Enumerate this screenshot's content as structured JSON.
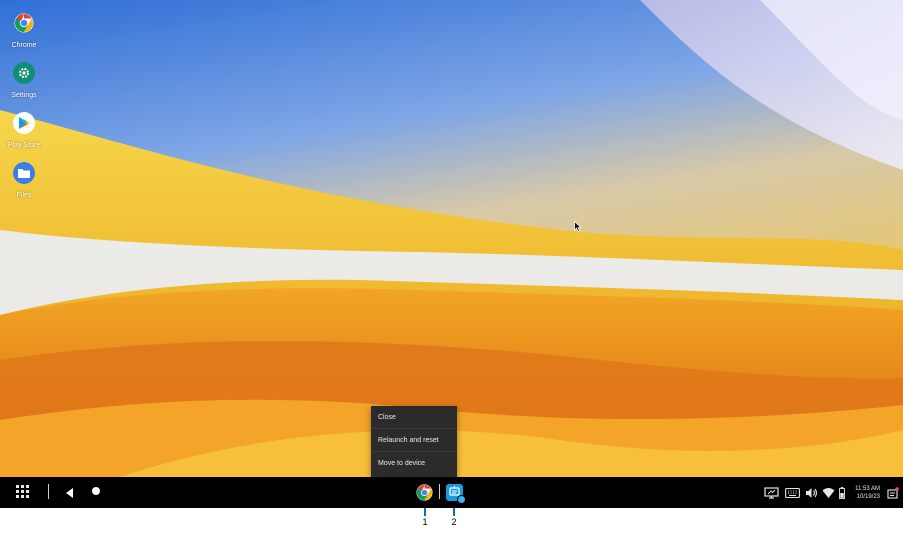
{
  "desktop": {
    "icons": [
      {
        "label": "Chrome",
        "icon": "chrome-icon"
      },
      {
        "label": "Settings",
        "icon": "gear-icon"
      },
      {
        "label": "Play Store",
        "icon": "play-store-icon"
      },
      {
        "label": "Files",
        "icon": "folder-icon"
      }
    ]
  },
  "context_menu": {
    "items": [
      {
        "label": "Close"
      },
      {
        "label": "Relaunch and reset"
      },
      {
        "label": "Move to device"
      }
    ]
  },
  "taskbar": {
    "launcher_icon": "app-grid-icon",
    "back_icon": "back-triangle-icon",
    "home_icon": "home-circle-icon",
    "apps": [
      {
        "icon": "chrome-icon"
      },
      {
        "icon": "helper-app-icon"
      }
    ],
    "tray": {
      "icons": [
        "screen-cast-icon",
        "keyboard-icon",
        "volume-icon",
        "wifi-icon",
        "battery-icon",
        "notifications-icon"
      ],
      "time": "11:53 AM",
      "date": "10/19/23"
    }
  },
  "annotations": {
    "markers": [
      {
        "label": "1"
      },
      {
        "label": "2"
      }
    ]
  },
  "colors": {
    "taskbar_bg": "#000000",
    "menu_bg": "#2b2b2b",
    "accent_blue": "#1a9be0"
  }
}
